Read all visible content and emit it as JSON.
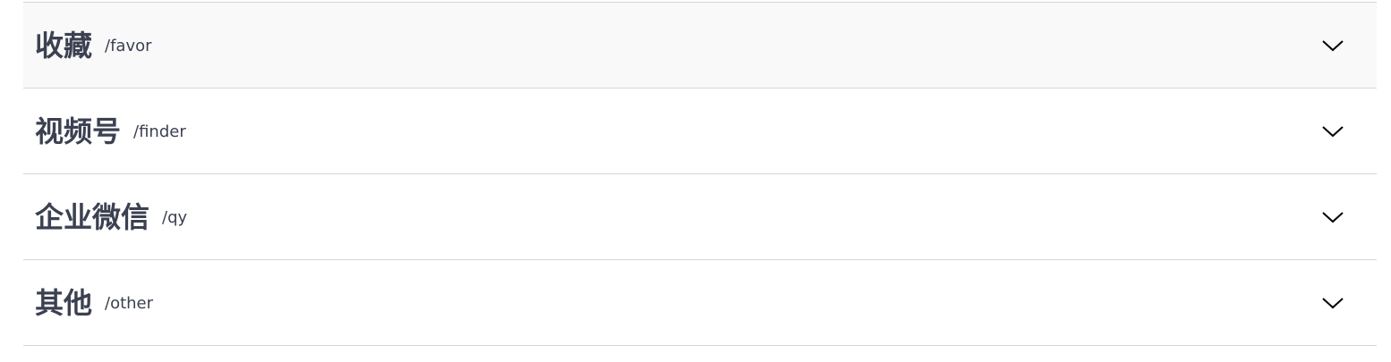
{
  "sections": [
    {
      "title": "收藏",
      "path": "/favor",
      "icon": "chevron-down-icon"
    },
    {
      "title": "视频号",
      "path": "/finder",
      "icon": "chevron-down-icon"
    },
    {
      "title": "企业微信",
      "path": "/qy",
      "icon": "chevron-down-icon"
    },
    {
      "title": "其他",
      "path": "/other",
      "icon": "chevron-down-icon"
    }
  ],
  "colors": {
    "text": "#3b4151",
    "divider": "#d6d6d6",
    "hover_bg": "#f9f9f9",
    "chevron": "#000000"
  }
}
